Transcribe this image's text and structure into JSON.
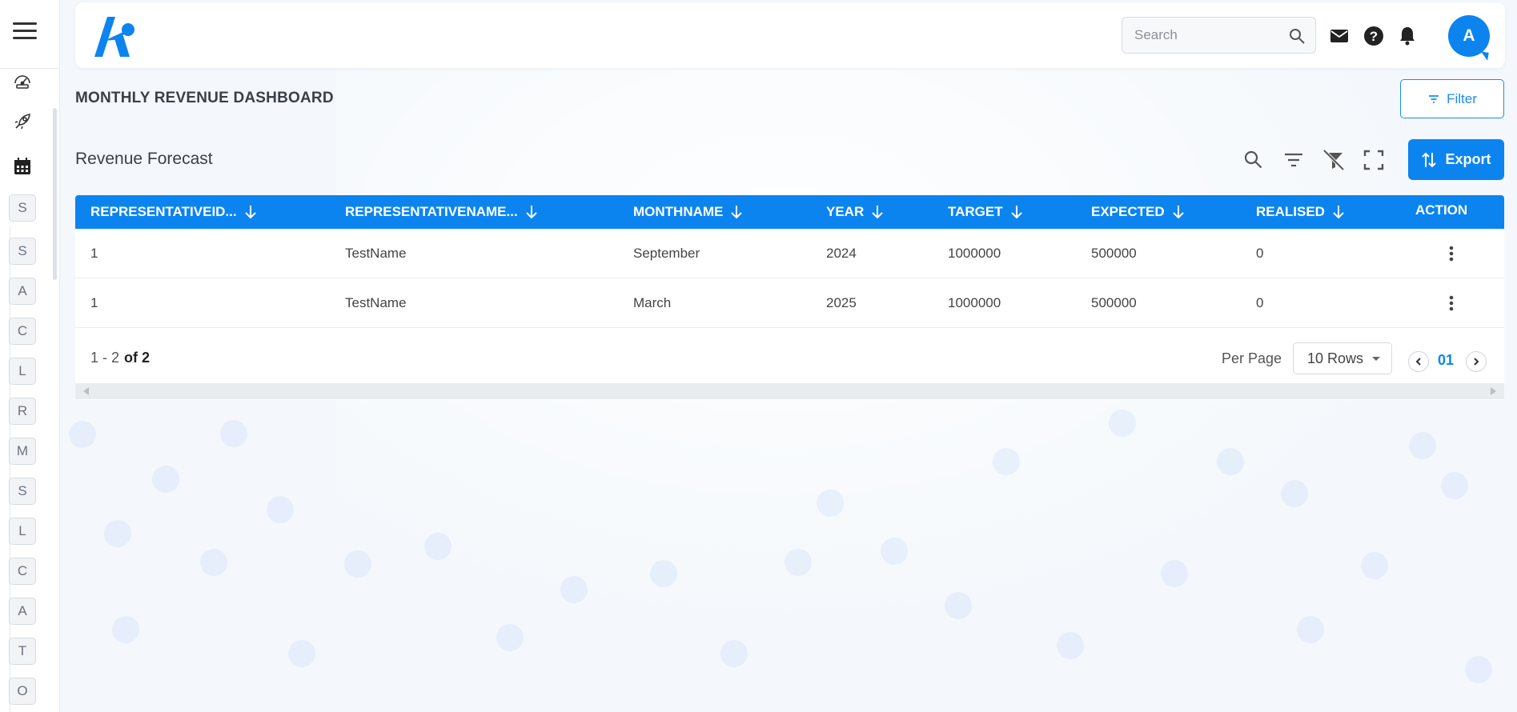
{
  "header": {
    "search_placeholder": "Search",
    "avatar_initial": "A",
    "icons": [
      "mail-icon",
      "help-icon",
      "bell-icon"
    ]
  },
  "sidebar": {
    "icon_items": [
      "dashboard-gauge-icon",
      "rocket-icon",
      "calendar-icon"
    ],
    "letter_items": [
      "S",
      "S",
      "A",
      "C",
      "L",
      "R",
      "M",
      "S",
      "L",
      "C",
      "A",
      "T",
      "O"
    ]
  },
  "page": {
    "title": "MONTHLY REVENUE DASHBOARD",
    "filter_label": "Filter",
    "section_title": "Revenue Forecast",
    "export_label": "Export"
  },
  "table": {
    "columns": [
      "REPRESENTATIVEID...",
      "REPRESENTATIVENAME...",
      "MONTHNAME",
      "YEAR",
      "TARGET",
      "EXPECTED",
      "REALISED",
      "ACTION"
    ],
    "rows": [
      [
        "1",
        "TestName",
        "September",
        "2024",
        "1000000",
        "500000",
        "0"
      ],
      [
        "1",
        "TestName",
        "March",
        "2025",
        "1000000",
        "500000",
        "0"
      ]
    ]
  },
  "pagination": {
    "range": "1 - 2",
    "total": "of 2",
    "per_page_label": "Per Page",
    "rows_option": "10 Rows",
    "current_page": "01"
  },
  "colors": {
    "accent": "#0b84f0",
    "background": "#f4f8fc"
  }
}
